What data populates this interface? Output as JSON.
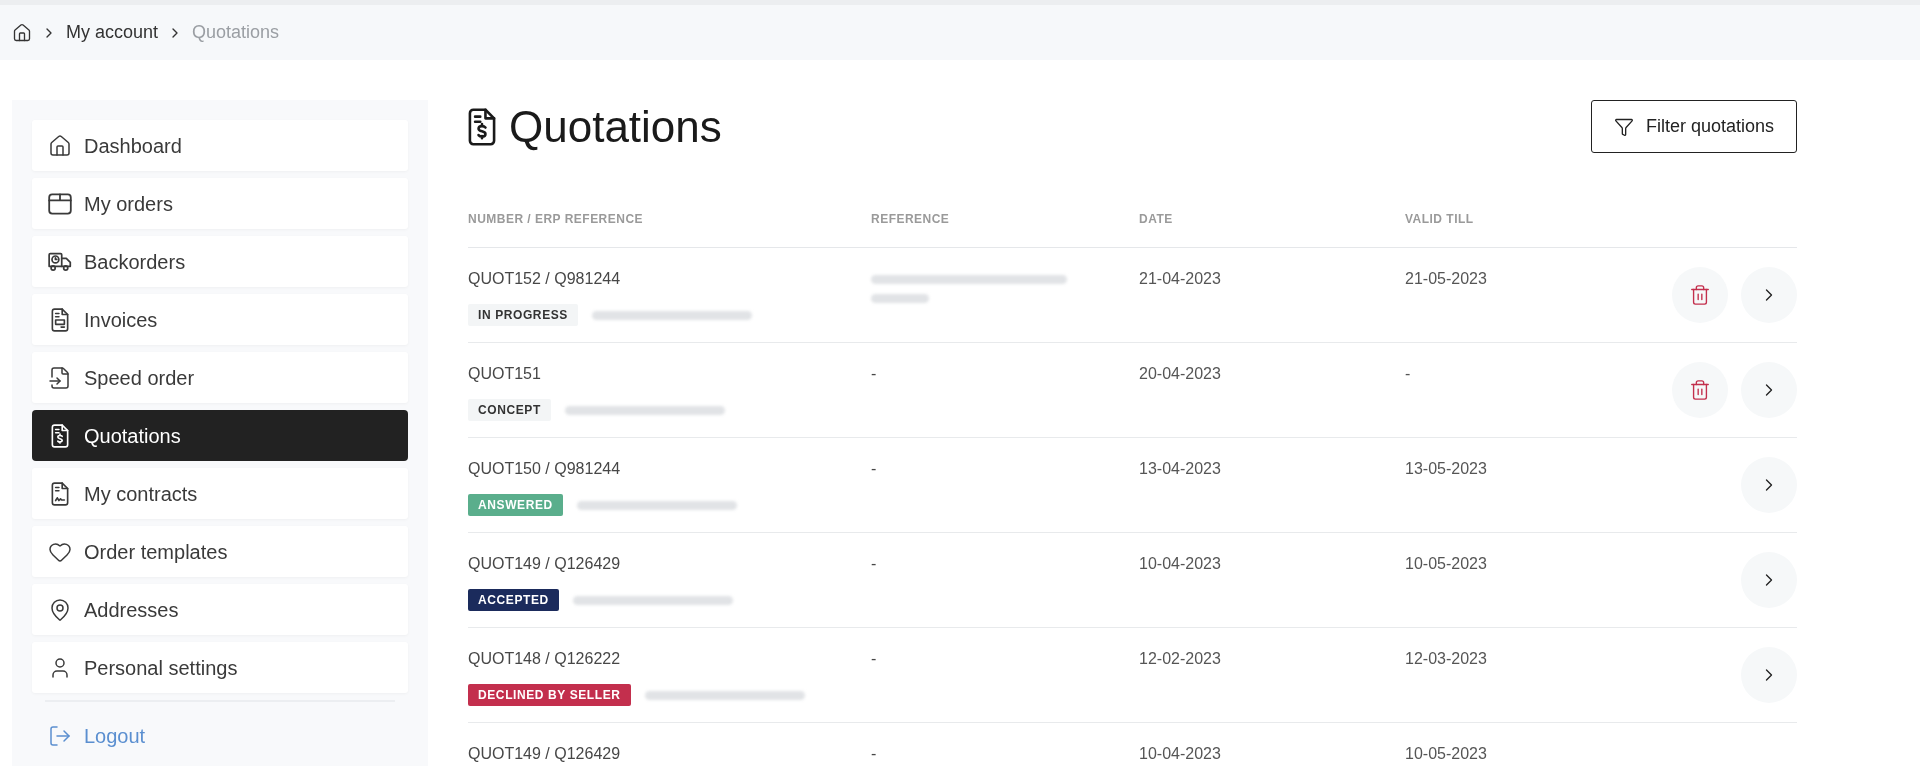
{
  "breadcrumb": {
    "items": [
      {
        "label": "My account",
        "current": false
      },
      {
        "label": "Quotations",
        "current": true
      }
    ]
  },
  "sidebar": {
    "items": [
      {
        "label": "Dashboard",
        "selected": false
      },
      {
        "label": "My orders",
        "selected": false
      },
      {
        "label": "Backorders",
        "selected": false
      },
      {
        "label": "Invoices",
        "selected": false
      },
      {
        "label": "Speed order",
        "selected": false
      },
      {
        "label": "Quotations",
        "selected": true
      },
      {
        "label": "My contracts",
        "selected": false
      },
      {
        "label": "Order templates",
        "selected": false
      },
      {
        "label": "Addresses",
        "selected": false
      },
      {
        "label": "Personal settings",
        "selected": false
      }
    ],
    "logout": {
      "label": "Logout"
    }
  },
  "page": {
    "title": "Quotations",
    "filter_button": {
      "label": "Filter quotations"
    }
  },
  "table": {
    "columns": [
      "NUMBER / ERP REFERENCE",
      "REFERENCE",
      "DATE",
      "VALID TILL"
    ],
    "rows": [
      {
        "number": "QUOT152 / Q981244",
        "status": {
          "label": "IN PROGRESS",
          "color": "#f3f5f6"
        },
        "email_blurred": true,
        "reference_blurred": true,
        "date": "21-04-2023",
        "valid_till": "21-05-2023",
        "can_delete": true,
        "can_open": true
      },
      {
        "number": "QUOT151",
        "status": {
          "label": "CONCEPT",
          "color": "#f3f5f6"
        },
        "email_blurred": true,
        "reference": "-",
        "date": "20-04-2023",
        "valid_till": "-",
        "can_delete": true,
        "can_open": true
      },
      {
        "number": "QUOT150 / Q981244",
        "status": {
          "label": "ANSWERED",
          "color": "#5aae8c"
        },
        "email_blurred": true,
        "reference": "-",
        "date": "13-04-2023",
        "valid_till": "13-05-2023",
        "can_delete": false,
        "can_open": true
      },
      {
        "number": "QUOT149 / Q126429",
        "status": {
          "label": "ACCEPTED",
          "color": "#1b2b5c"
        },
        "email_blurred": true,
        "reference": "-",
        "date": "10-04-2023",
        "valid_till": "10-05-2023",
        "can_delete": false,
        "can_open": true
      },
      {
        "number": "QUOT148 / Q126222",
        "status": {
          "label": "DECLINED BY SELLER",
          "color": "#c32f4d"
        },
        "email_blurred": true,
        "reference": "-",
        "date": "12-02-2023",
        "valid_till": "12-03-2023",
        "can_delete": false,
        "can_open": true
      },
      {
        "number": "QUOT149 / Q126429",
        "reference": "-",
        "date": "10-04-2023",
        "valid_till": "10-05-2023",
        "can_delete": false,
        "can_open": false
      }
    ]
  }
}
